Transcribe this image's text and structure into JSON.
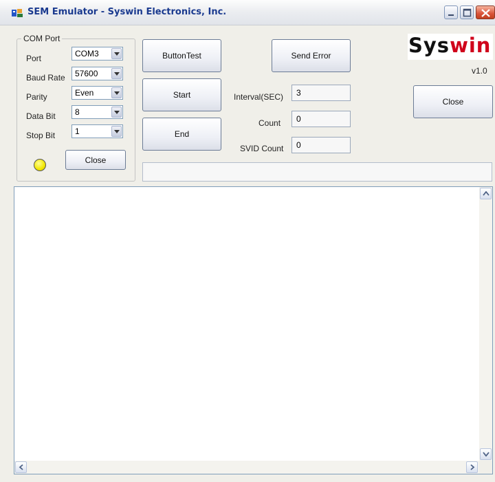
{
  "window": {
    "title": "SEM Emulator - Syswin Electronics, Inc."
  },
  "com_port": {
    "legend": "COM Port",
    "port": {
      "label": "Port",
      "value": "COM3"
    },
    "baud_rate": {
      "label": "Baud Rate",
      "value": "57600"
    },
    "parity": {
      "label": "Parity",
      "value": "Even"
    },
    "data_bit": {
      "label": "Data Bit",
      "value": "8"
    },
    "stop_bit": {
      "label": "Stop Bit",
      "value": "1"
    },
    "close_label": "Close",
    "led_color": "#f2e600"
  },
  "buttons": {
    "button_test": "ButtonTest",
    "start": "Start",
    "end": "End",
    "send_error": "Send Error",
    "close": "Close"
  },
  "fields": {
    "interval": {
      "label": "Interval(SEC)",
      "value": "3"
    },
    "count": {
      "label": "Count",
      "value": "0"
    },
    "svid_count": {
      "label": "SVID Count",
      "value": "0"
    }
  },
  "status_text": "",
  "logo": {
    "part1": "Sys",
    "part2": "win",
    "accent": "#d0001b"
  },
  "version": "v1.0",
  "output_text": ""
}
